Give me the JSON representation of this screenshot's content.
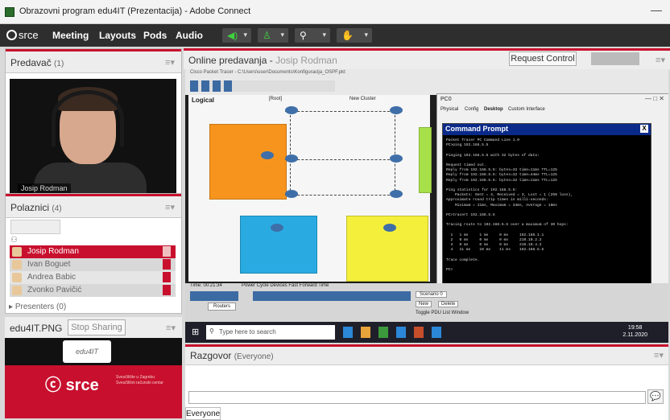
{
  "window": {
    "title": "Obrazovni program edu4IT (Prezentacija) - Adobe Connect"
  },
  "menu": {
    "logo": "srce",
    "items": [
      "Meeting",
      "Layouts",
      "Pods",
      "Audio"
    ]
  },
  "presenter_pod": {
    "title": "Predavač",
    "count": "(1)",
    "cam_name": "Josip Rodman"
  },
  "attendees_pod": {
    "title": "Polaznici",
    "count": "(4)",
    "presenters_label": "Presenters (0)",
    "list": [
      "Josip Rodman",
      "Ivan Boguet",
      "Andrea Babic",
      "Zvonko Pavičić"
    ]
  },
  "file_pod": {
    "title": "edu4IT.PNG",
    "stop_button": "Stop Sharing",
    "logo_text": "edu4IT",
    "srce_logo": "srce",
    "srce_tagline_1": "Sveučilište u Zagrebu",
    "srce_tagline_2": "Sveučilišni računski centar"
  },
  "share_pod": {
    "title": "Online predavanja",
    "presenter_name": "Josip Rodman",
    "request_button": "Request Control"
  },
  "packet_tracer": {
    "app_title": "Cisco Packet Tracer - C:\\Users\\user\\Documents\\Konfiguracija_OSPF.pkt",
    "logical_label": "Logical",
    "root_label": "[Root]",
    "cluster_label": "New Cluster",
    "time_label": "Time: 00:21:34",
    "power_label": "Power Cycle Devices  Fast Forward Time",
    "routers_label": "Routers",
    "scenario_label": "Scenario 0",
    "new_button": "New",
    "delete_button": "Delete",
    "toggle_label": "Toggle PDU List Window"
  },
  "pc_window": {
    "title": "PC0",
    "tabs": [
      "Physical",
      "Config",
      "Desktop",
      "Custom Interface"
    ],
    "cmd_title": "Command Prompt",
    "cmd_text": "Packet Tracer PC Command Line 1.0\nPC>ping 192.168.5.5\n\nPinging 192.168.5.5 with 32 bytes of data:\n\nRequest timed out.\nReply from 192.168.5.5: bytes=32 time=11ms TTL=125\nReply from 192.168.5.5: bytes=32 time=44ms TTL=125\nReply from 192.168.5.5: bytes=32 time=11ms TTL=125\n\nPing statistics for 192.168.5.5:\n    Packets: Sent = 4, Received = 3, Lost = 1 (25% loss),\nApproximate round trip times in milli-seconds:\n    Minimum = 11ms, Maximum = 34ms, Average = 18ms\n\nPC>tracert 192.168.5.5\n\nTracing route to 192.168.5.5 over a maximum of 30 hops:\n\n  1   1 ms     1 ms     0 ms     192.168.1.1\n  2   0 ms     0 ms     0 ms     210.10.2.2\n  3   0 ms     0 ms     0 ms     210.10.4.2\n  4   11 ms    10 ms    11 ms    192.168.5.5\n\nTrace complete.\n\nPC>"
  },
  "taskbar": {
    "search_placeholder": "Type here to search",
    "clock_time": "19:58",
    "clock_date": "2.11.2020"
  },
  "chat_pod": {
    "title": "Razgovor",
    "audience": "(Everyone)",
    "tab": "Everyone"
  },
  "colors": {
    "accent_red": "#c8102e",
    "menu_bg": "#2e2e2e"
  }
}
